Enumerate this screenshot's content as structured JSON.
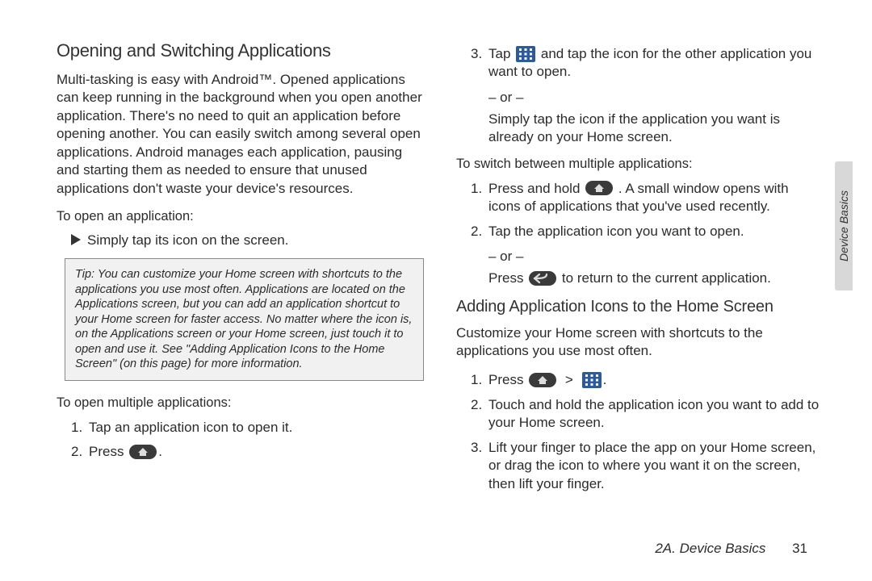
{
  "left": {
    "title": "Opening and Switching Applications",
    "intro": "Multi-tasking is easy with Android™. Opened applications can keep running in the background when you open another application. There's no need to quit an application before opening another. You can easily switch among several open applications. Android manages each application, pausing and starting them as needed to ensure that unused applications don't waste your device's resources.",
    "open_app_label": "To open  an application:",
    "open_app_bullet": "Simply tap its icon on the screen.",
    "tip_label": "Tip:",
    "tip_body": "You can customize your Home screen with shortcuts to the applications you use most often. Applications are located on the Applications screen, but you can add an application shortcut to your Home screen for faster access. No matter where the icon is, on the Applications screen or your Home screen, just touch it to open and use it. See \"Adding Application Icons to the Home Screen\" (on this page) for more information.",
    "open_multi_label": "To open multiple applications:",
    "multi_steps": {
      "s1": "Tap an application icon to open it.",
      "s2": "Press "
    }
  },
  "right": {
    "step3a": "Tap ",
    "step3b": " and tap the icon for the other application you want to open.",
    "or": "– or –",
    "step3_alt": "Simply tap the icon if the application you want is already on your Home screen.",
    "switch_label": "To switch between multiple applications:",
    "switch_s1a": "Press and hold ",
    "switch_s1b": ". A small window opens with icons of applications that you've used recently.",
    "switch_s2": "Tap the application icon you want to open.",
    "switch_s2_alt_a": "Press ",
    "switch_s2_alt_b": " to return to the current application.",
    "adding_title": "Adding Application Icons to the Home Screen",
    "adding_intro": "Customize your Home screen with shortcuts to the applications you use most often.",
    "add_s1": "Press ",
    "add_s2": "Touch and hold the application icon you want to add to your Home screen.",
    "add_s3": "Lift your finger to place the app on your Home screen, or drag the icon to where you want it on the screen, then lift your finger."
  },
  "footer": {
    "section": "2A. Device Basics",
    "page": "31"
  },
  "sidetab": "Device Basics"
}
